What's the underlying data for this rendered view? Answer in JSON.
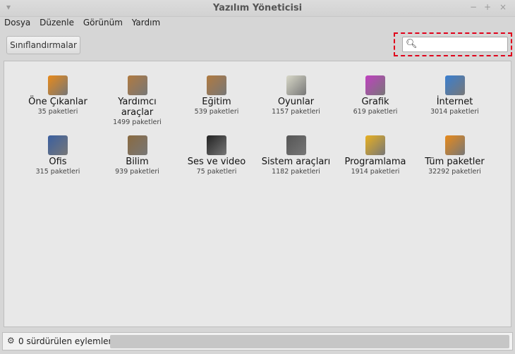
{
  "window": {
    "title": "Yazılım Yöneticisi",
    "controls": [
      "−",
      "+",
      "×"
    ]
  },
  "menu": [
    "Dosya",
    "Düzenle",
    "Görünüm",
    "Yardım"
  ],
  "toolbar": {
    "categories_button": "Sınıflandırmalar",
    "search_placeholder": "",
    "search_value": ""
  },
  "categories": [
    {
      "name": "Öne Çıkanlar",
      "count": "35 paketleri",
      "color": "#e88a1a"
    },
    {
      "name": "Yardımcı araçlar",
      "count": "1499 paketleri",
      "color": "#b07a40"
    },
    {
      "name": "Eğitim",
      "count": "539 paketleri",
      "color": "#b07a40"
    },
    {
      "name": "Oyunlar",
      "count": "1157 paketleri",
      "color": "#d8d8c8"
    },
    {
      "name": "Grafik",
      "count": "619 paketleri",
      "color": "#c040c0"
    },
    {
      "name": "İnternet",
      "count": "3014 paketleri",
      "color": "#3a7fd0"
    },
    {
      "name": "Ofis",
      "count": "315 paketleri",
      "color": "#3a5fa0"
    },
    {
      "name": "Bilim",
      "count": "939 paketleri",
      "color": "#8a6a40"
    },
    {
      "name": "Ses ve video",
      "count": "75 paketleri",
      "color": "#222222"
    },
    {
      "name": "Sistem araçları",
      "count": "1182 paketleri",
      "color": "#555555"
    },
    {
      "name": "Programlama",
      "count": "1914 paketleri",
      "color": "#e8b020"
    },
    {
      "name": "Tüm paketler",
      "count": "32292 paketleri",
      "color": "#e88a1a"
    }
  ],
  "status": {
    "text": "0 sürdürülen eylemler",
    "progress": 0
  }
}
